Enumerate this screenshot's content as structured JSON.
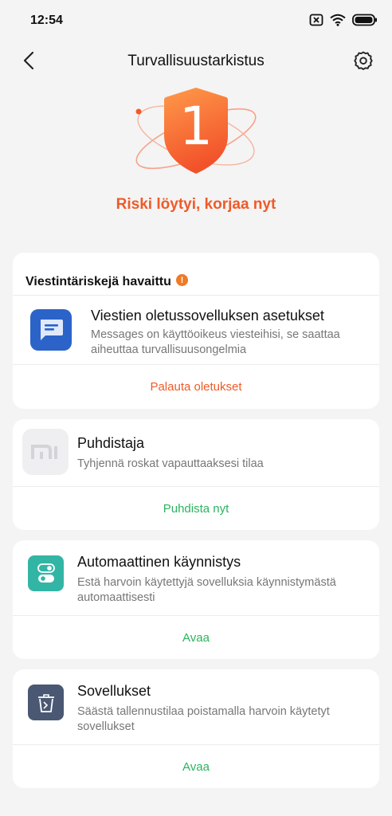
{
  "status_bar": {
    "time": "12:54",
    "icons": [
      "sim-off-icon",
      "wifi-icon",
      "battery-icon"
    ]
  },
  "header": {
    "title": "Turvallisuustarkistus",
    "back_icon": "back-arrow-icon",
    "settings_icon": "gear-icon"
  },
  "hero": {
    "risk_count": "1",
    "risk_message": "Riski löytyi, korjaa nyt",
    "accent_color": "#f05a28"
  },
  "cards": {
    "messaging": {
      "header": "Viestintäriskejä havaittu",
      "badge": "!",
      "title": "Viestien oletussovelluksen asetukset",
      "desc_line1": "Messages on käyttöoikeus viesteihisi, se saattaa",
      "desc_line2": "aiheuttaa turvallisuusongelmia",
      "action": "Palauta oletukset",
      "action_color": "#f05a28"
    },
    "cleaner": {
      "title": "Puhdistaja",
      "desc_line1": "Tyhjennä roskat vapauttaaksesi tilaa",
      "action": "Puhdista nyt",
      "action_color": "#2db35f"
    },
    "autostart": {
      "title": "Automaattinen käynnistys",
      "desc_line1": "Estä harvoin käytettyjä sovelluksia käynnistymästä",
      "desc_line2": "automaattisesti",
      "action": "Avaa",
      "action_color": "#2db35f"
    },
    "apps": {
      "title": "Sovellukset",
      "desc_line1": "Säästä tallennustilaa poistamalla harvoin käytetyt",
      "desc_line2": "sovellukset",
      "action": "Avaa",
      "action_color": "#2db35f"
    }
  }
}
